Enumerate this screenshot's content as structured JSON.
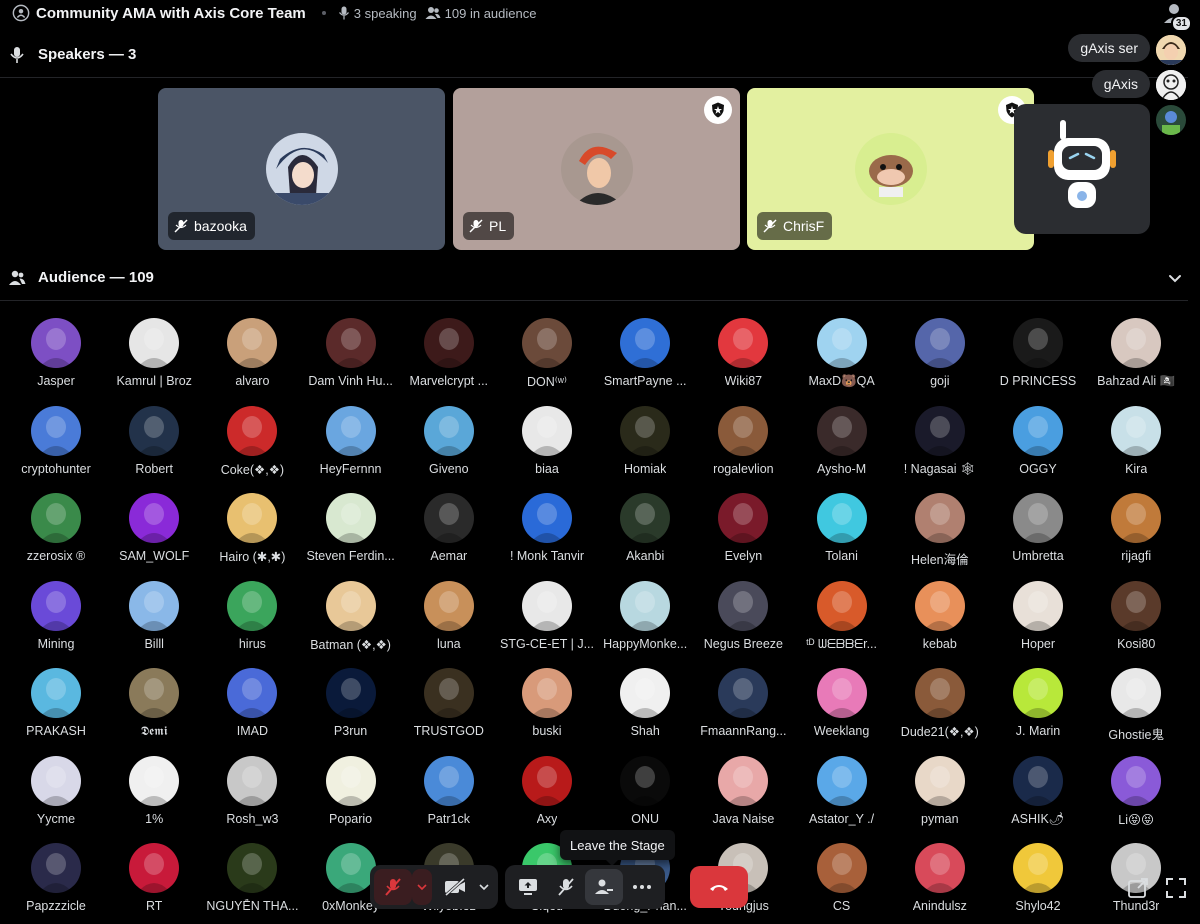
{
  "header": {
    "title": "Community AMA with Axis Core Team",
    "speaking": "3 speaking",
    "audience": "109 in audience",
    "notification_count": "31"
  },
  "speakers_section": {
    "label": "Speakers — 3"
  },
  "speakers": [
    {
      "name": "bazooka",
      "bg": "#4b5566",
      "has_badge": false
    },
    {
      "name": "PL",
      "bg": "#b3a09b",
      "has_badge": true
    },
    {
      "name": "ChrisF",
      "bg": "#e3f0a0",
      "has_badge": true
    }
  ],
  "side_users": [
    {
      "label": "gAxis ser"
    },
    {
      "label": "gAxis"
    }
  ],
  "audience_section": {
    "label": "Audience — 109"
  },
  "audience": [
    {
      "name": "Jasper",
      "color": "#7d4fc4"
    },
    {
      "name": "Kamrul | Broz",
      "color": "#e6e6e6"
    },
    {
      "name": "alvaro",
      "color": "#c9a07a"
    },
    {
      "name": "Dam Vinh Hu...",
      "color": "#5b2a2a"
    },
    {
      "name": "Marvelcrypt ...",
      "color": "#3d1a1a"
    },
    {
      "name": "DON⁽ʷ⁾",
      "color": "#6b4a3a"
    },
    {
      "name": "SmartPayne ...",
      "color": "#2f6fd6"
    },
    {
      "name": "Wiki87",
      "color": "#e2383e"
    },
    {
      "name": "MaxD🐻QA",
      "color": "#9fd3f0"
    },
    {
      "name": "goji",
      "color": "#5566aa"
    },
    {
      "name": "D PRINCESS",
      "color": "#1a1a1a"
    },
    {
      "name": "Bahzad Ali 🏴‍☠️",
      "color": "#d8c8c0"
    },
    {
      "name": "cryptohunter",
      "color": "#4a7bd8"
    },
    {
      "name": "Robert",
      "color": "#22324a"
    },
    {
      "name": "Coke(❖,❖)",
      "color": "#cc2a2a"
    },
    {
      "name": "HeyFernnn",
      "color": "#6aa6e0"
    },
    {
      "name": "Giveno",
      "color": "#5aa7d8"
    },
    {
      "name": "biaa",
      "color": "#e8e8e8"
    },
    {
      "name": "Homiak",
      "color": "#2a2a1a"
    },
    {
      "name": "rogalevlion",
      "color": "#8a5a3a"
    },
    {
      "name": "Aysho-M",
      "color": "#3a2a2a"
    },
    {
      "name": "! Nagasai 🕸",
      "color": "#1a1a2a"
    },
    {
      "name": "OGGY",
      "color": "#4a9ee0"
    },
    {
      "name": "Kira",
      "color": "#c8e0e8"
    },
    {
      "name": "zzerosix ®",
      "color": "#3a8a4a"
    },
    {
      "name": "SAM_WOLF",
      "color": "#8a2ad8"
    },
    {
      "name": "Hairo (✱,✱)",
      "color": "#e8c070"
    },
    {
      "name": "Steven Ferdin...",
      "color": "#d8e8d0"
    },
    {
      "name": "Aemar",
      "color": "#2a2a2a"
    },
    {
      "name": "! Monk Tanvir",
      "color": "#2a6ad8"
    },
    {
      "name": "Akanbi",
      "color": "#2a3a2a"
    },
    {
      "name": "Evelyn",
      "color": "#7a1a2a"
    },
    {
      "name": "Tolani",
      "color": "#40c8e0"
    },
    {
      "name": "Helen海倫",
      "color": "#b08070"
    },
    {
      "name": "Umbretta",
      "color": "#8a8a8a"
    },
    {
      "name": "rijagfi",
      "color": "#c07a3a"
    },
    {
      "name": "Mining",
      "color": "#6a4ad8"
    },
    {
      "name": "Billl",
      "color": "#8ab8e8"
    },
    {
      "name": "hirus",
      "color": "#3ba55c"
    },
    {
      "name": "Batman (❖,❖)",
      "color": "#e8c898"
    },
    {
      "name": "luna",
      "color": "#c8905a"
    },
    {
      "name": "STG-CE-ET | J...",
      "color": "#e8e8e8"
    },
    {
      "name": "HappyMonke...",
      "color": "#b8d8e0"
    },
    {
      "name": "Negus Breeze",
      "color": "#4a4a5a"
    },
    {
      "name": "ᵗᴰ ᗯᗴᗷᗷᗴr...",
      "color": "#d85a2a"
    },
    {
      "name": "kebab",
      "color": "#e8905a"
    },
    {
      "name": "Hoper",
      "color": "#e8e0d8"
    },
    {
      "name": "Kosi80",
      "color": "#5a3a2a"
    },
    {
      "name": "PRAKASH",
      "color": "#5ab8e0"
    },
    {
      "name": "𝕯𝖊𝖒𝖎",
      "color": "#8a7a5a"
    },
    {
      "name": "IMAD",
      "color": "#4a6ad8"
    },
    {
      "name": "P3run",
      "color": "#0a1a3a"
    },
    {
      "name": "TRUSTGOD",
      "color": "#3a3020"
    },
    {
      "name": "buski",
      "color": "#d89a7a"
    },
    {
      "name": "Shah",
      "color": "#f0f0f0"
    },
    {
      "name": "FmaannRang...",
      "color": "#2a3a5a"
    },
    {
      "name": "Weeklang",
      "color": "#e87ab8"
    },
    {
      "name": "Dude21(❖,❖)",
      "color": "#8a5a3a"
    },
    {
      "name": "J. Marin",
      "color": "#b8e83a"
    },
    {
      "name": "Ghostie鬼",
      "color": "#e8e8e8"
    },
    {
      "name": "Yycme",
      "color": "#d8d8e8"
    },
    {
      "name": "1%",
      "color": "#f0f0f0"
    },
    {
      "name": "Rosh_w3",
      "color": "#c8c8c8"
    },
    {
      "name": "Popario",
      "color": "#f0f0e0"
    },
    {
      "name": "Patr1ck",
      "color": "#4a8ad8"
    },
    {
      "name": "Axy",
      "color": "#b81a1a"
    },
    {
      "name": "ONU",
      "color": "#0a0a0a"
    },
    {
      "name": "Java Naise",
      "color": "#e8a8a8"
    },
    {
      "name": "Astator_Y ./",
      "color": "#5aa8e8"
    },
    {
      "name": "pyman",
      "color": "#e8d8c8"
    },
    {
      "name": "ASHIK🌶",
      "color": "#1a2a4a"
    },
    {
      "name": "Li😝😝",
      "color": "#8a5ad8"
    },
    {
      "name": "Papzzzicle",
      "color": "#2a2a4a"
    },
    {
      "name": "RT",
      "color": "#c81a3a"
    },
    {
      "name": "NGUYỄN THA...",
      "color": "#2a3a1a"
    },
    {
      "name": "0xMonkey",
      "color": "#3aa87a"
    },
    {
      "name": "Wilyob.ez",
      "color": "#3a3a2a"
    },
    {
      "name": "Siqeu",
      "color": "#3ac86a"
    },
    {
      "name": "Duong_Phan...",
      "color": "#3a5a8a"
    },
    {
      "name": "Youngjus",
      "color": "#c8c0b8"
    },
    {
      "name": "CS",
      "color": "#a8603a"
    },
    {
      "name": "Anindulsz",
      "color": "#d84a5a"
    },
    {
      "name": "Shylo42",
      "color": "#f0c83a"
    },
    {
      "name": "Thund3r",
      "color": "#c8c8c8"
    }
  ],
  "tooltip": {
    "text": "Leave the Stage"
  },
  "controls": {
    "mic": "microphone-muted",
    "camera": "camera-off",
    "screen": "screen-share",
    "stage": "move-to-audience",
    "invite": "invite-speaker",
    "more": "more-options",
    "leave": "disconnect"
  },
  "colors": {
    "background": "#000000",
    "leave_button": "#da373c",
    "muted_bg": "#3a1d20"
  }
}
